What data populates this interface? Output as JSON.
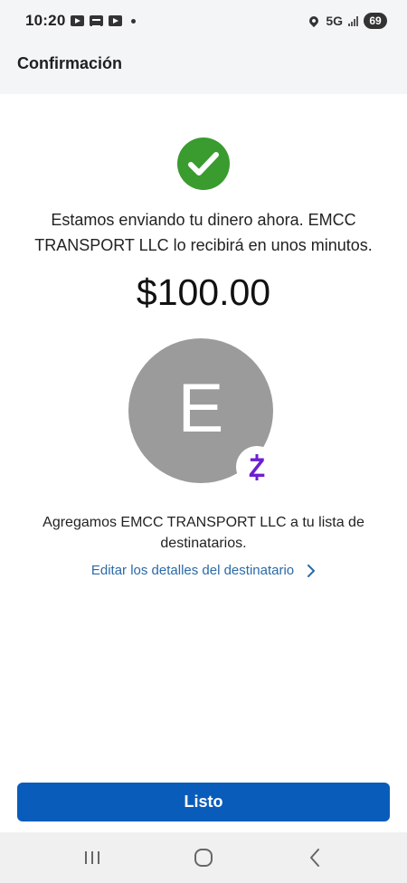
{
  "status_bar": {
    "time": "10:20",
    "notification_icons": [
      "youtube-icon",
      "calendar-icon",
      "youtube-icon"
    ],
    "network": "5G",
    "battery": "69"
  },
  "header": {
    "title": "Confirmación"
  },
  "confirmation": {
    "message": "Estamos enviando tu dinero ahora. EMCC TRANSPORT LLC lo recibirá en unos minutos.",
    "amount": "$100.00",
    "status_color": "#3a9b2f"
  },
  "recipient": {
    "initial": "E",
    "badge_icon": "zelle-icon",
    "badge_letter": "Z",
    "avatar_color": "#9b9b9b",
    "brand_color": "#6d1ed4"
  },
  "added_message": "Agregamos EMCC TRANSPORT LLC a tu lista de destinatarios.",
  "edit_link": {
    "label": "Editar los detalles del destinatario"
  },
  "primary_button": {
    "label": "Listo",
    "color": "#0a5cba"
  },
  "nav_bar": {
    "buttons": [
      "recents-icon",
      "home-icon",
      "back-icon"
    ]
  }
}
